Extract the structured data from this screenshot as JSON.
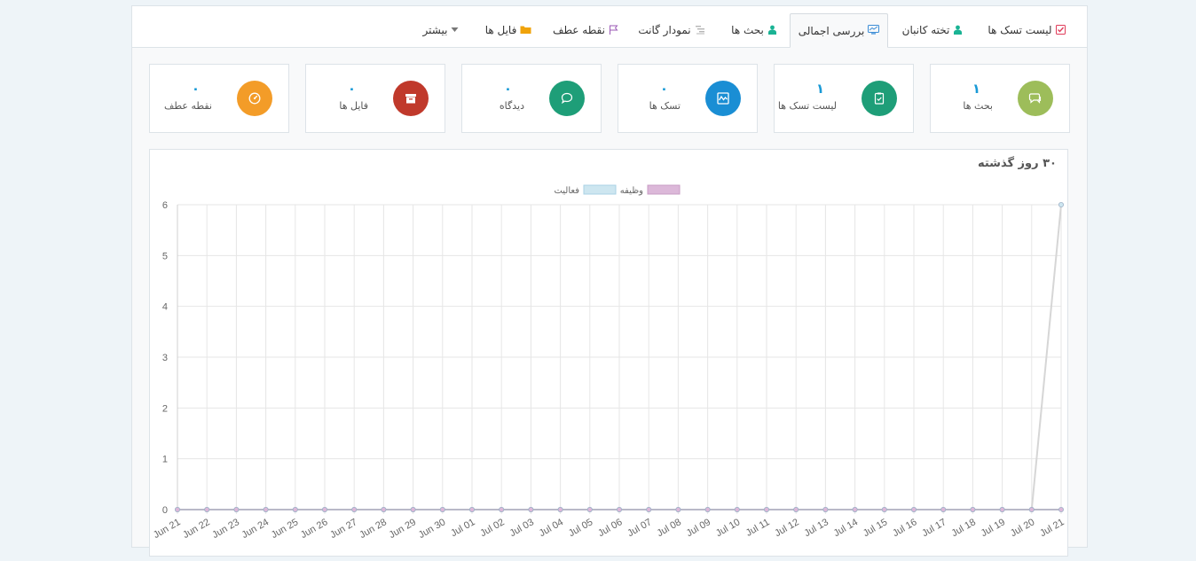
{
  "tabs": [
    {
      "label": "لیست تسک ها",
      "icon": "checkbox-icon",
      "color": "#e03c5a",
      "active": false
    },
    {
      "label": "تخته کانبان",
      "icon": "users-icon",
      "color": "#1ab394",
      "active": false
    },
    {
      "label": "بررسی اجمالی",
      "icon": "monitor-icon",
      "color": "#3c8dd6",
      "active": true
    },
    {
      "label": "بحث ها",
      "icon": "users-icon",
      "color": "#1ab394",
      "active": false
    },
    {
      "label": "نمودار گانت",
      "icon": "gantt-icon",
      "color": "#b5b5b5",
      "active": false
    },
    {
      "label": "نقطه عطف",
      "icon": "flag-icon",
      "color": "#9b59b6",
      "active": false
    },
    {
      "label": "فایل ها",
      "icon": "folder-icon",
      "color": "#f0a30a",
      "active": false
    },
    {
      "label": "بیشتر",
      "icon": "caret-down-icon",
      "color": "#777",
      "active": false
    }
  ],
  "stats": [
    {
      "label": "بحث ها",
      "value": "۱",
      "icon": "comments-icon",
      "color": "#9dbd5a"
    },
    {
      "label": "لیست تسک ها",
      "value": "۱",
      "icon": "clipboard-icon",
      "color": "#1e9e78"
    },
    {
      "label": "تسک ها",
      "value": "۰",
      "icon": "activity-icon",
      "color": "#1a8ed4"
    },
    {
      "label": "دیدگاه",
      "value": "۰",
      "icon": "comment-icon",
      "color": "#1e9e78"
    },
    {
      "label": "فایل ها",
      "value": "۰",
      "icon": "archive-icon",
      "color": "#c0392b"
    },
    {
      "label": "نقطه عطف",
      "value": "۰",
      "icon": "dashboard-icon",
      "color": "#f39c28"
    }
  ],
  "chart_title": "۳۰ روز گذشته",
  "chart_data": {
    "type": "line",
    "title": "۳۰ روز گذشته",
    "categories": [
      "Jun 21",
      "Jun 22",
      "Jun 23",
      "Jun 24",
      "Jun 25",
      "Jun 26",
      "Jun 27",
      "Jun 28",
      "Jun 29",
      "Jun 30",
      "Jul 01",
      "Jul 02",
      "Jul 03",
      "Jul 04",
      "Jul 05",
      "Jul 06",
      "Jul 07",
      "Jul 08",
      "Jul 09",
      "Jul 10",
      "Jul 11",
      "Jul 12",
      "Jul 13",
      "Jul 14",
      "Jul 15",
      "Jul 16",
      "Jul 17",
      "Jul 18",
      "Jul 19",
      "Jul 20",
      "Jul 21"
    ],
    "series": [
      {
        "name": "فعالیت",
        "color": "#cde6f0",
        "values": [
          0,
          0,
          0,
          0,
          0,
          0,
          0,
          0,
          0,
          0,
          0,
          0,
          0,
          0,
          0,
          0,
          0,
          0,
          0,
          0,
          0,
          0,
          0,
          0,
          0,
          0,
          0,
          0,
          0,
          0,
          6
        ]
      },
      {
        "name": "وظیفه",
        "color": "#dcb8d9",
        "values": [
          0,
          0,
          0,
          0,
          0,
          0,
          0,
          0,
          0,
          0,
          0,
          0,
          0,
          0,
          0,
          0,
          0,
          0,
          0,
          0,
          0,
          0,
          0,
          0,
          0,
          0,
          0,
          0,
          0,
          0,
          0
        ]
      }
    ],
    "ylim": [
      0,
      6
    ],
    "yticks": [
      0,
      1,
      2,
      3,
      4,
      5,
      6
    ],
    "legend": "top-center",
    "grid": true
  }
}
